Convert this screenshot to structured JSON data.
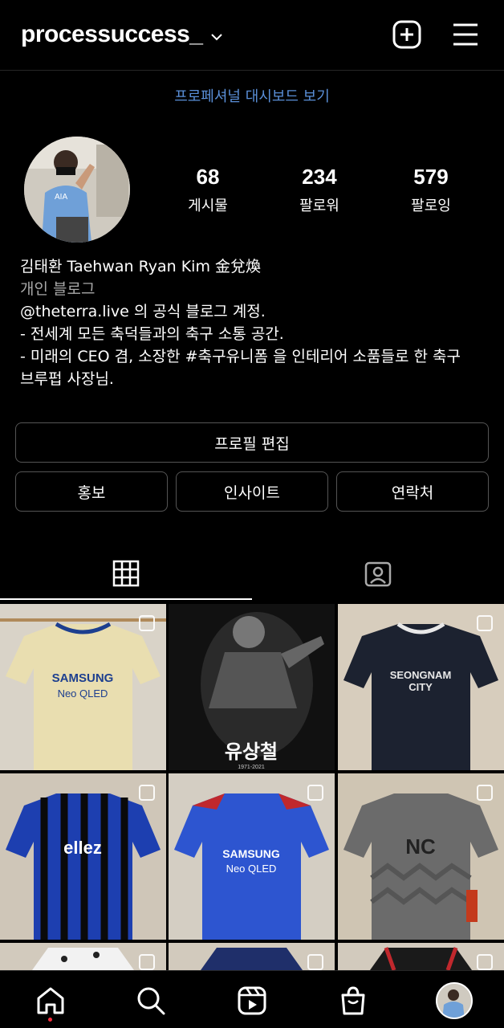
{
  "header": {
    "username": "processuccess_",
    "dashboard_link": "프로페셔널 대시보드 보기"
  },
  "profile": {
    "stats": [
      {
        "num": "68",
        "label": "게시물"
      },
      {
        "num": "234",
        "label": "팔로워"
      },
      {
        "num": "579",
        "label": "팔로잉"
      }
    ],
    "name": "김태환 Taehwan Ryan Kim 金兌煥",
    "category": "개인 블로그",
    "bio_lines": [
      "@theterra.live 의 공식 블로그 계정.",
      "- 전세계 모든 축덕들과의 축구 소통 공간.",
      "- 미래의 CEO 겸, 소장한 #축구유니폼 을 인테리어 소품들로 한 축구",
      "브루펍 사장님."
    ]
  },
  "buttons": {
    "edit_profile": "프로필 편집",
    "promote": "홍보",
    "insights": "인사이트",
    "contact": "연락처"
  },
  "posts": [
    {
      "label": "SAMSUNG Neo QLED",
      "shirt": "#e9deb0",
      "accent": "#1d3f8f",
      "bg": "#d9d3c8"
    },
    {
      "label": "유상철",
      "sub": "1971-2021",
      "shirt": "#222",
      "accent": "#888",
      "bg": "#111"
    },
    {
      "label": "SEONGNAM CITY",
      "shirt": "#1c2230",
      "accent": "#e8e8e8",
      "bg": "#d7cdbd"
    },
    {
      "label": "ellez",
      "shirt": "#1d3fb0",
      "accent": "#0a0a0a",
      "bg": "#cfc6b8"
    },
    {
      "label": "SAMSUNG Neo QLED",
      "shirt": "#2d55d0",
      "accent": "#c0282d",
      "bg": "#d4cec3"
    },
    {
      "label": "NC",
      "shirt": "#6b6b6b",
      "accent": "#222",
      "bg": "#cfc5b3"
    }
  ],
  "colors": {
    "link": "#5a8fd8",
    "border": "#555555",
    "notification_dot": "#ff3040"
  }
}
